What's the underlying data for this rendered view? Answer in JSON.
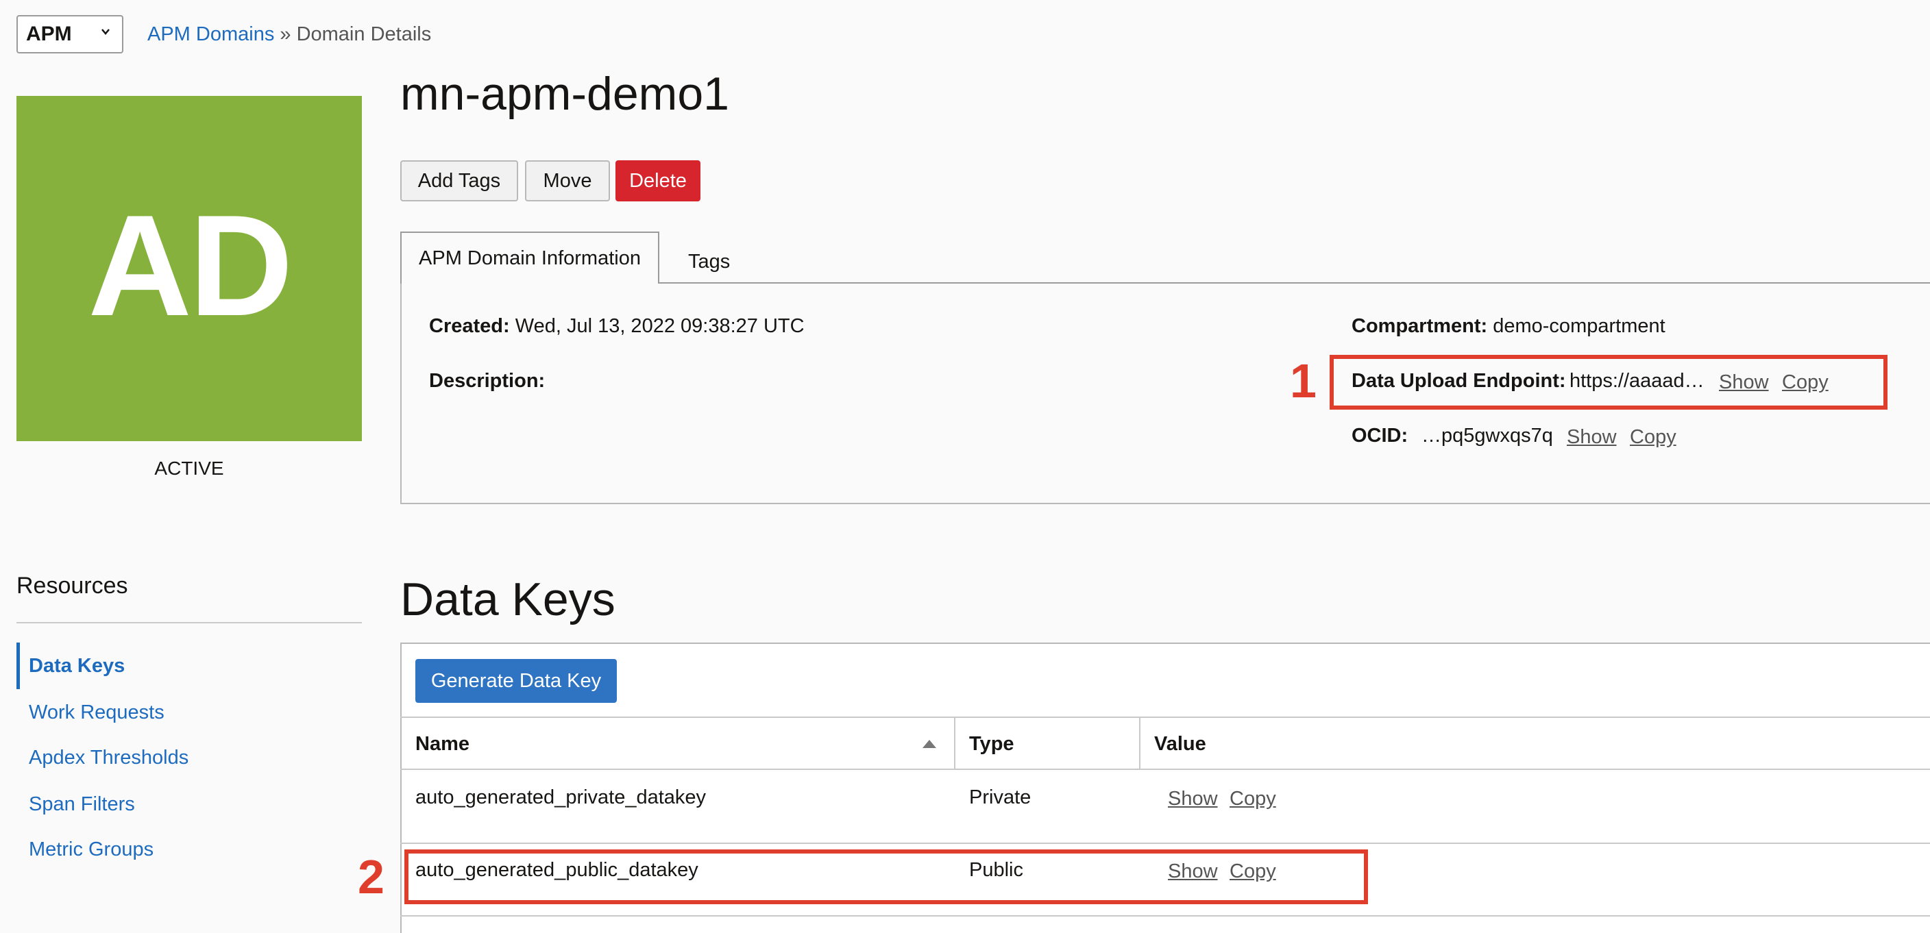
{
  "top": {
    "app_select": "APM",
    "breadcrumb": {
      "parent": "APM Domains",
      "separator": " » ",
      "current": "Domain Details"
    }
  },
  "domain": {
    "avatar_initials": "AD",
    "avatar_color": "#85b13c",
    "status": "ACTIVE",
    "title": "mn-apm-demo1"
  },
  "actions": {
    "add_tags": "Add Tags",
    "move": "Move",
    "delete": "Delete"
  },
  "tabs": [
    {
      "label": "APM Domain Information"
    },
    {
      "label": "Tags"
    }
  ],
  "info": {
    "created_label": "Created:",
    "created_value": "Wed, Jul 13, 2022 09:38:27 UTC",
    "description_label": "Description:",
    "compartment_label": "Compartment:",
    "compartment_value": "demo-compartment",
    "endpoint_label": "Data Upload Endpoint:",
    "endpoint_value": "https://aaaad…",
    "ocid_label": "OCID:",
    "ocid_value": "…pq5gwxqs7q",
    "show": "Show",
    "copy": "Copy"
  },
  "markers": {
    "one": "1",
    "two": "2"
  },
  "resources": {
    "title": "Resources",
    "items": [
      {
        "label": "Data Keys"
      },
      {
        "label": "Work Requests"
      },
      {
        "label": "Apdex Thresholds"
      },
      {
        "label": "Span Filters"
      },
      {
        "label": "Metric Groups"
      }
    ]
  },
  "data_keys": {
    "title": "Data Keys",
    "generate_button": "Generate Data Key",
    "columns": {
      "name": "Name",
      "type": "Type",
      "value": "Value"
    },
    "rows": [
      {
        "name": "auto_generated_private_datakey",
        "type": "Private",
        "show": "Show",
        "copy": "Copy"
      },
      {
        "name": "auto_generated_public_datakey",
        "type": "Public",
        "show": "Show",
        "copy": "Copy"
      }
    ]
  },
  "colors": {
    "accent": "#1d6bbf",
    "delete": "#d6252d",
    "highlight": "#e03e2d",
    "primary_button": "#2e74c2"
  }
}
